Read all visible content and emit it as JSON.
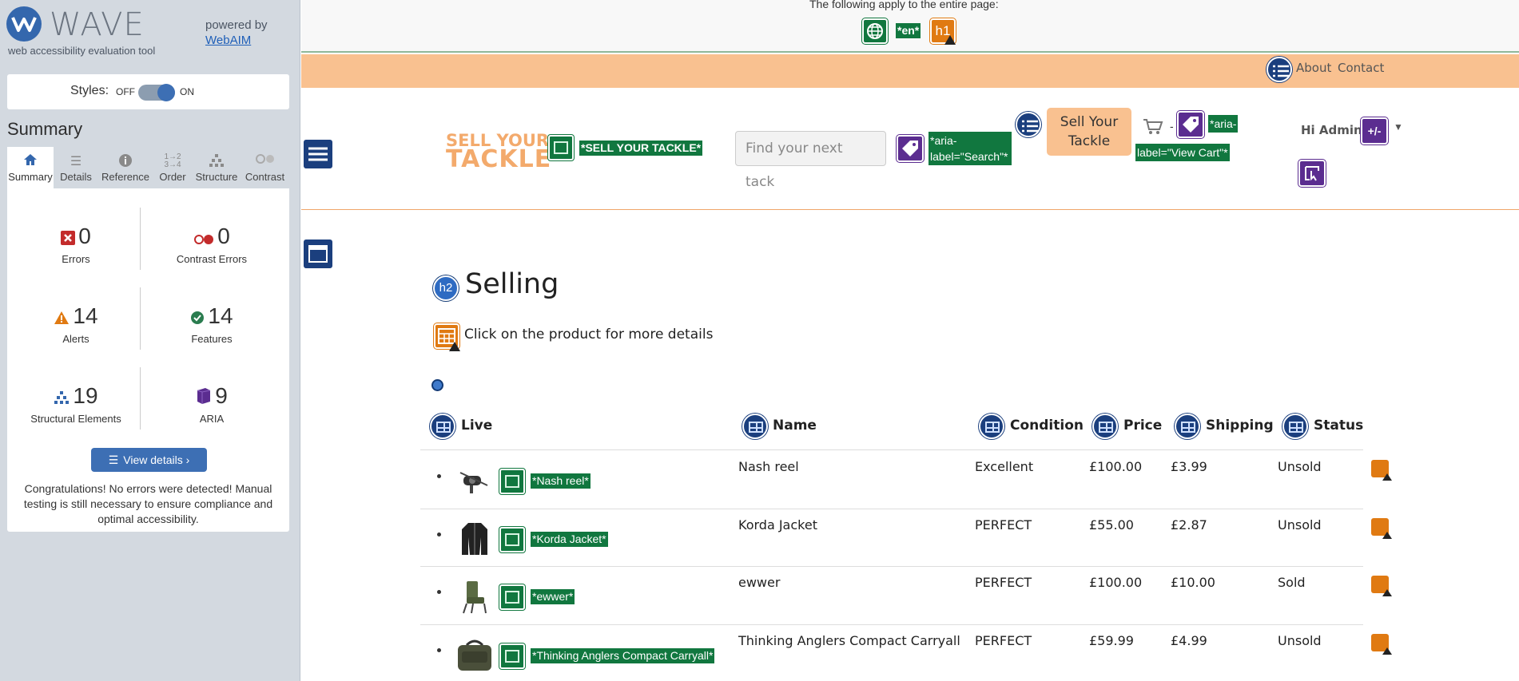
{
  "wave": {
    "title": "WAVE",
    "tagline": "web accessibility evaluation tool",
    "powered_by": "powered by",
    "webaim_link": "WebAIM",
    "styles_label": "Styles:",
    "styles_off": "OFF",
    "styles_on": "ON",
    "summary_heading": "Summary",
    "tabs": [
      {
        "label": "Summary",
        "icon": "home-icon"
      },
      {
        "label": "Details",
        "icon": "list-icon"
      },
      {
        "label": "Reference",
        "icon": "info-icon"
      },
      {
        "label": "Order",
        "icon": "order-icon"
      },
      {
        "label": "Structure",
        "icon": "structure-icon"
      },
      {
        "label": "Contrast",
        "icon": "contrast-icon"
      }
    ],
    "stats": {
      "errors": {
        "value": "0",
        "label": "Errors",
        "color": "#c32b2b"
      },
      "contrast_errors": {
        "value": "0",
        "label": "Contrast Errors",
        "color": "#c32b2b"
      },
      "alerts": {
        "value": "14",
        "label": "Alerts",
        "color": "#e07a12"
      },
      "features": {
        "value": "14",
        "label": "Features",
        "color": "#2a7c4f"
      },
      "structural": {
        "value": "19",
        "label": "Structural Elements",
        "color": "#3467ad"
      },
      "aria": {
        "value": "9",
        "label": "ARIA",
        "color": "#5b2d90"
      }
    },
    "view_details": "View details ›",
    "congrats": "Congratulations! No errors were detected! Manual testing is still necessary to ensure compliance and optimal accessibility."
  },
  "page": {
    "banner_text": "The following apply to the entire page:",
    "lang_badge": "*en*",
    "h1_label": "h1",
    "nav": {
      "about": "About",
      "contact": "Contact"
    },
    "logo_line1": "SELL YOUR",
    "logo_line2": "TACKLE",
    "logo_alt_badge": "*SELL YOUR TACKLE*",
    "search_placeholder": "Find your next tack",
    "search_badge_l1": "*aria-",
    "search_badge_l2": "label=\"Search\"*",
    "sell_button_l1": "Sell Your",
    "sell_button_l2": "Tackle",
    "cart_dash": "-",
    "cart_badge_l1": "*aria-",
    "cart_badge_l2": "label=\"View Cart\"*",
    "hi_admin": "Hi Admin",
    "admin_toggle": "+/-",
    "h2_label": "h2",
    "selling_heading": "Selling",
    "instructions": "Click on the product for more details",
    "table": {
      "headers": [
        "Live",
        "Name",
        "Condition",
        "Price",
        "Shipping",
        "Status"
      ],
      "rows": [
        {
          "alt": "*Nash reel*",
          "name": "Nash reel",
          "condition": "Excellent",
          "price": "£100.00",
          "shipping": "£3.99",
          "status": "Unsold"
        },
        {
          "alt": "*Korda Jacket*",
          "name": "Korda Jacket",
          "condition": "PERFECT",
          "price": "£55.00",
          "shipping": "£2.87",
          "status": "Unsold"
        },
        {
          "alt": "*ewwer*",
          "name": "ewwer",
          "condition": "PERFECT",
          "price": "£100.00",
          "shipping": "£10.00",
          "status": "Sold"
        },
        {
          "alt": "*Thinking Anglers Compact Carryall*",
          "name": "Thinking Anglers Compact Carryall",
          "condition": "PERFECT",
          "price": "£59.99",
          "shipping": "£4.99",
          "status": "Unsold"
        }
      ]
    }
  }
}
